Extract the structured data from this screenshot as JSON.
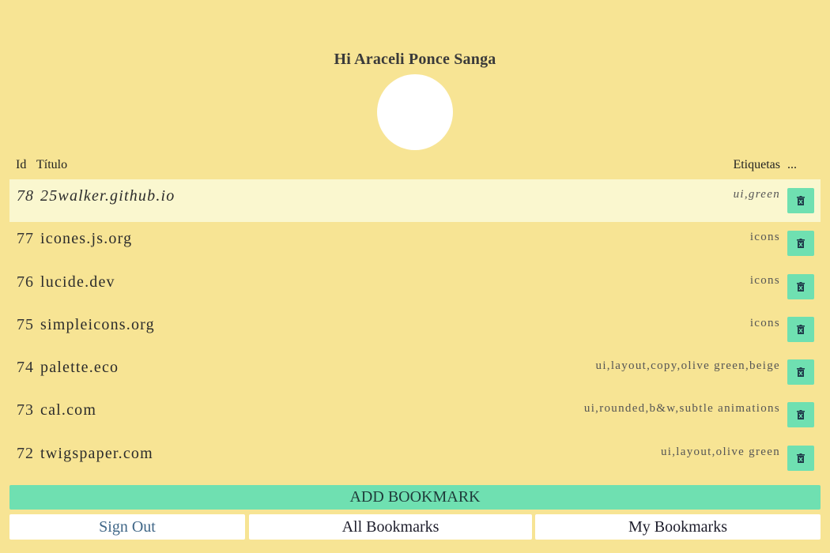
{
  "greeting": "Hi Araceli Ponce Sanga",
  "table": {
    "headers": {
      "id": "Id",
      "title": "Título",
      "tags": "Etiquetas",
      "actions": "..."
    },
    "rows": [
      {
        "id": "78",
        "title": "25walker.github.io",
        "tags": "ui,green",
        "selected": true
      },
      {
        "id": "77",
        "title": "icones.js.org",
        "tags": "icons",
        "selected": false
      },
      {
        "id": "76",
        "title": "lucide.dev",
        "tags": "icons",
        "selected": false
      },
      {
        "id": "75",
        "title": "simpleicons.org",
        "tags": "icons",
        "selected": false
      },
      {
        "id": "74",
        "title": "palette.eco",
        "tags": "ui,layout,copy,olive green,beige",
        "selected": false
      },
      {
        "id": "73",
        "title": "cal.com",
        "tags": "ui,rounded,b&w,subtle animations",
        "selected": false
      },
      {
        "id": "72",
        "title": "twigspaper.com",
        "tags": "ui,layout,olive green",
        "selected": false
      }
    ],
    "delete_icon": "trash-icon"
  },
  "actions": {
    "add_label": "ADD BOOKMARK",
    "sign_out_label": "Sign Out",
    "all_bookmarks_label": "All Bookmarks",
    "my_bookmarks_label": "My Bookmarks"
  },
  "colors": {
    "background": "#f7e494",
    "accent": "#6fe0b1",
    "selected_row": "#faf7cf",
    "sign_out_text": "#3f6687"
  }
}
